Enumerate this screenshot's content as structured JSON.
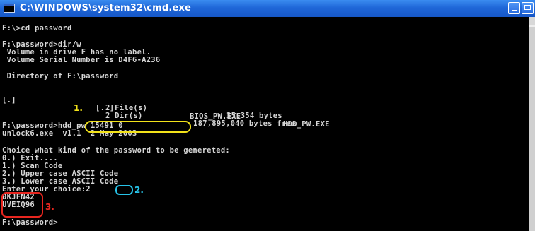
{
  "window": {
    "title": "C:\\WINDOWS\\system32\\cmd.exe",
    "icon": "cmd-window-icon",
    "controls": [
      "minimize",
      "maximize"
    ]
  },
  "console": {
    "lines": [
      "F:\\>cd password",
      "F:\\password>dir/w",
      " Volume in drive F has no label.",
      " Volume Serial Number is D4F6-A236",
      " Directory of F:\\password",
      "",
      "F:\\password>hdd_pw 15491 0",
      "unlock6.exe  v1.1  2 May 2003",
      "Choice what kind of the password to be genereted:",
      "0.) Exit....",
      "1.) Scan Code",
      "2.) Upper case ASCII Code",
      "3.) Lower case ASCII Code",
      "Enter your choice:2",
      "0KJFN42",
      "UVEIQ96",
      "F:\\password>"
    ],
    "dir_listing": {
      "entries": [
        "[.]",
        "[..]",
        "BIOS_PW.EXE",
        "HDD_PW.EXE"
      ],
      "file_count": "2 File(s)",
      "file_bytes": "35,354 bytes",
      "dir_count": "2 Dir(s)",
      "free_bytes": "187,895,040 bytes free"
    }
  },
  "annotations": [
    {
      "label": "1.",
      "color": "#f2e21a"
    },
    {
      "label": "2.",
      "color": "#27c3e8"
    },
    {
      "label": "3.",
      "color": "#e8261f"
    }
  ]
}
